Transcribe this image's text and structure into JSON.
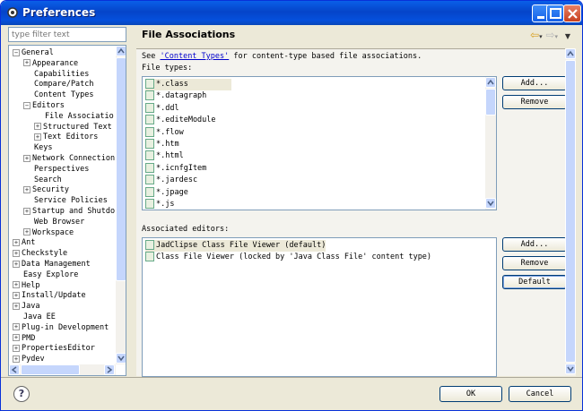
{
  "window": {
    "title": "Preferences"
  },
  "filter": {
    "placeholder": "type filter text"
  },
  "tree": [
    {
      "label": "General",
      "level": 0,
      "exp": "-"
    },
    {
      "label": "Appearance",
      "level": 1,
      "exp": "+"
    },
    {
      "label": "Capabilities",
      "level": 1,
      "exp": ""
    },
    {
      "label": "Compare/Patch",
      "level": 1,
      "exp": ""
    },
    {
      "label": "Content Types",
      "level": 1,
      "exp": ""
    },
    {
      "label": "Editors",
      "level": 1,
      "exp": "-"
    },
    {
      "label": "File Associatio",
      "level": 2,
      "exp": "",
      "selected": true
    },
    {
      "label": "Structured Text",
      "level": 2,
      "exp": "+"
    },
    {
      "label": "Text Editors",
      "level": 2,
      "exp": "+"
    },
    {
      "label": "Keys",
      "level": 1,
      "exp": ""
    },
    {
      "label": "Network Connection",
      "level": 1,
      "exp": "+"
    },
    {
      "label": "Perspectives",
      "level": 1,
      "exp": ""
    },
    {
      "label": "Search",
      "level": 1,
      "exp": ""
    },
    {
      "label": "Security",
      "level": 1,
      "exp": "+"
    },
    {
      "label": "Service Policies",
      "level": 1,
      "exp": ""
    },
    {
      "label": "Startup and Shutdo",
      "level": 1,
      "exp": "+"
    },
    {
      "label": "Web Browser",
      "level": 1,
      "exp": ""
    },
    {
      "label": "Workspace",
      "level": 1,
      "exp": "+"
    },
    {
      "label": "Ant",
      "level": 0,
      "exp": "+"
    },
    {
      "label": "Checkstyle",
      "level": 0,
      "exp": "+"
    },
    {
      "label": "Data Management",
      "level": 0,
      "exp": "+"
    },
    {
      "label": "Easy Explore",
      "level": 0,
      "exp": ""
    },
    {
      "label": "Help",
      "level": 0,
      "exp": "+"
    },
    {
      "label": "Install/Update",
      "level": 0,
      "exp": "+"
    },
    {
      "label": "Java",
      "level": 0,
      "exp": "+"
    },
    {
      "label": "Java EE",
      "level": 0,
      "exp": ""
    },
    {
      "label": "Plug-in Development",
      "level": 0,
      "exp": "+"
    },
    {
      "label": "PMD",
      "level": 0,
      "exp": "+"
    },
    {
      "label": "PropertiesEditor",
      "level": 0,
      "exp": "+"
    },
    {
      "label": "Pydev",
      "level": 0,
      "exp": "+"
    }
  ],
  "panel": {
    "title": "File Associations",
    "see_prefix": "See ",
    "see_link": "'Content Types'",
    "see_suffix": " for content-type based file associations.",
    "file_types_label": "File types:",
    "associated_label": "Associated editors:"
  },
  "file_types": [
    "*.class",
    "*.datagraph",
    "*.ddl",
    "*.editeModule",
    "*.flow",
    "*.htm",
    "*.html",
    "*.icnfgItem",
    "*.jardesc",
    "*.jpage",
    "*.js"
  ],
  "editors": [
    "JadClipse Class File Viewer (default)",
    "Class File Viewer (locked by 'Java Class File' content type)"
  ],
  "buttons": {
    "add1": "Add...",
    "remove1": "Remove",
    "add2": "Add...",
    "remove2": "Remove",
    "default": "Default",
    "ok": "OK",
    "cancel": "Cancel"
  },
  "help_glyph": "?"
}
